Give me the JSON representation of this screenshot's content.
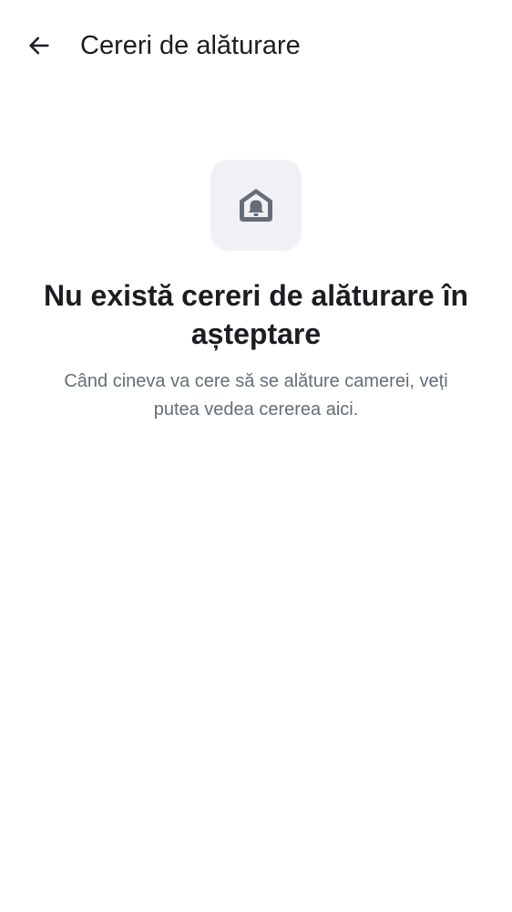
{
  "header": {
    "back_icon": "arrow-left-icon",
    "title": "Cereri de alăturare"
  },
  "empty_state": {
    "icon": "home-bell-icon",
    "heading": "Nu există cereri de alăturare în așteptare",
    "description": "Când cineva va cere să se alăture camerei, veți putea vedea cererea aici."
  },
  "colors": {
    "background": "#ffffff",
    "text_primary": "#1b1d21",
    "text_secondary": "#656d77",
    "icon_tile": "#f0f1f5",
    "icon": "#656d77"
  }
}
